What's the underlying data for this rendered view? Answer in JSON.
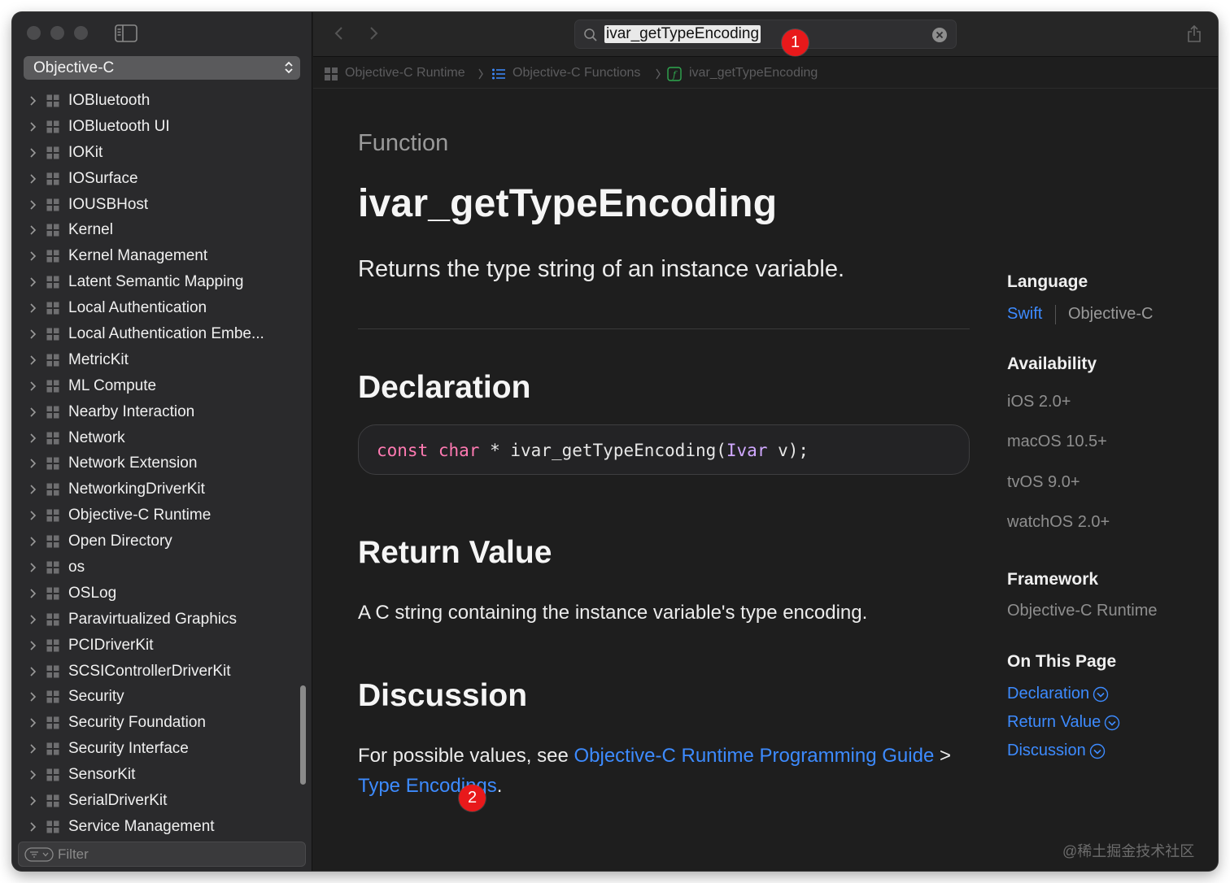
{
  "sidebar": {
    "language_select": "Objective-C",
    "items": [
      "IOBluetooth",
      "IOBluetooth UI",
      "IOKit",
      "IOSurface",
      "IOUSBHost",
      "Kernel",
      "Kernel Management",
      "Latent Semantic Mapping",
      "Local Authentication",
      "Local Authentication Embe...",
      "MetricKit",
      "ML Compute",
      "Nearby Interaction",
      "Network",
      "Network Extension",
      "NetworkingDriverKit",
      "Objective-C Runtime",
      "Open Directory",
      "os",
      "OSLog",
      "Paravirtualized Graphics",
      "PCIDriverKit",
      "SCSIControllerDriverKit",
      "Security",
      "Security Foundation",
      "Security Interface",
      "SensorKit",
      "SerialDriverKit",
      "Service Management"
    ],
    "filter_placeholder": "Filter"
  },
  "toolbar": {
    "search_value": "ivar_getTypeEncoding"
  },
  "breadcrumb": [
    "Objective-C Runtime",
    "Objective-C Functions",
    "ivar_getTypeEncoding"
  ],
  "doc": {
    "kind": "Function",
    "title": "ivar_getTypeEncoding",
    "abstract": "Returns the type string of an instance variable.",
    "declaration_heading": "Declaration",
    "code": {
      "kw1": "const",
      "kw2": "char",
      "mid": " * ivar_getTypeEncoding(",
      "type": "Ivar",
      "end": " v);"
    },
    "return_heading": "Return Value",
    "return_text": "A C string containing the instance variable's type encoding.",
    "discussion_heading": "Discussion",
    "discussion_prefix": "For possible values, see ",
    "discussion_link1": "Objective-C Runtime Programming Guide",
    "discussion_sep": " >",
    "discussion_link2": "Type Encodings",
    "discussion_suffix": "."
  },
  "aside": {
    "language_heading": "Language",
    "language_swift": "Swift",
    "language_objc": "Objective-C",
    "availability_heading": "Availability",
    "availability": [
      "iOS 2.0+",
      "macOS 10.5+",
      "tvOS 9.0+",
      "watchOS 2.0+"
    ],
    "framework_heading": "Framework",
    "framework": "Objective-C Runtime",
    "on_this_page_heading": "On This Page",
    "on_this_page": [
      "Declaration",
      "Return Value",
      "Discussion"
    ]
  },
  "annotations": {
    "badge1": "1",
    "badge2": "2"
  },
  "watermark": "@稀土掘金技术社区",
  "colors": {
    "link": "#3d8bff",
    "badge": "#e8191b",
    "keyword": "#ff7ab2",
    "type": "#d0a8ff"
  }
}
